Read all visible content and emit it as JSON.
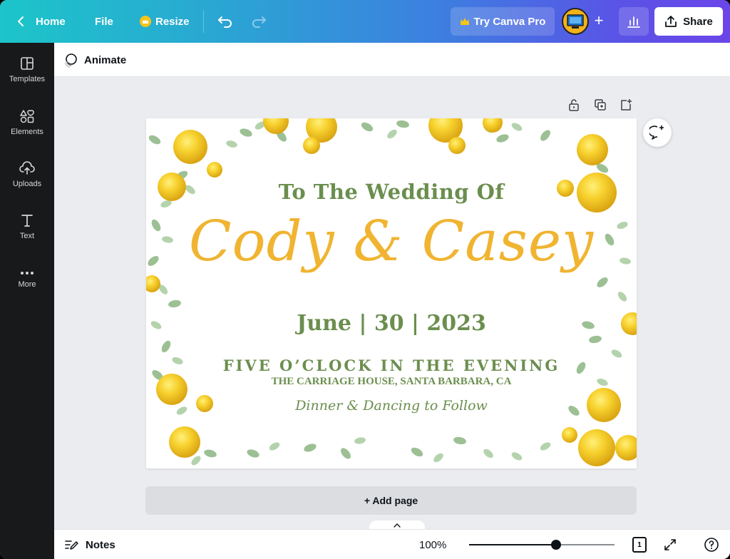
{
  "topbar": {
    "home_label": "Home",
    "file_label": "File",
    "resize_label": "Resize",
    "pro_label": "Try Canva Pro",
    "share_label": "Share",
    "accent_crown": "#f5c518"
  },
  "sidebar": {
    "items": [
      {
        "label": "Templates",
        "icon": "templates-icon"
      },
      {
        "label": "Elements",
        "icon": "elements-icon"
      },
      {
        "label": "Uploads",
        "icon": "uploads-icon"
      },
      {
        "label": "Text",
        "icon": "text-icon"
      },
      {
        "label": "More",
        "icon": "more-icon"
      }
    ]
  },
  "context_toolbar": {
    "animate_label": "Animate"
  },
  "design": {
    "line1": "To The Wedding Of",
    "names": "Cody & Casey",
    "date": "June | 30 | 2023",
    "time": "FIVE O’CLOCK IN THE EVENING",
    "venue": "THE CARRIAGE HOUSE, SANTA BARBARA, CA",
    "footer": "Dinner & Dancing to Follow",
    "colors": {
      "green": "#6b8e4e",
      "gold": "#f0b431",
      "rose": "#f7d12e",
      "leaf": "#8fb68a"
    }
  },
  "add_page_label": "+ Add page",
  "bottombar": {
    "notes_label": "Notes",
    "zoom_label": "100%",
    "zoom_fraction": 0.6,
    "page_count": "1"
  }
}
